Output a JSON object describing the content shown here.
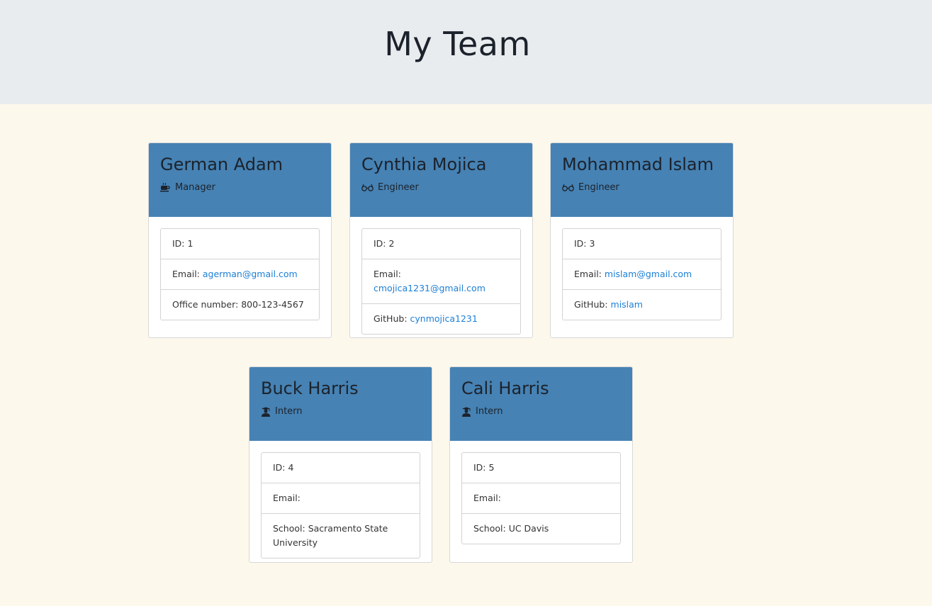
{
  "header": {
    "title": "My Team"
  },
  "labels": {
    "id": "ID: ",
    "email": "Email: ",
    "office": "Office number: ",
    "github": "GitHub: ",
    "school": "School: "
  },
  "team": [
    {
      "name": "German Adam",
      "role": "Manager",
      "role_icon": "coffee-icon",
      "id": "1",
      "email": "agerman@gmail.com",
      "office": "800-123-4567"
    },
    {
      "name": "Cynthia Mojica",
      "role": "Engineer",
      "role_icon": "glasses-icon",
      "id": "2",
      "email": "cmojica1231@gmail.com",
      "github": "cynmojica1231"
    },
    {
      "name": "Mohammad Islam",
      "role": "Engineer",
      "role_icon": "glasses-icon",
      "id": "3",
      "email": "mislam@gmail.com",
      "github": "mislam"
    },
    {
      "name": "Buck Harris",
      "role": "Intern",
      "role_icon": "graduate-icon",
      "id": "4",
      "email": "",
      "school": "Sacramento State University"
    },
    {
      "name": "Cali Harris",
      "role": "Intern",
      "role_icon": "graduate-icon",
      "id": "5",
      "email": "",
      "school": "UC Davis"
    }
  ],
  "colors": {
    "header_bg": "#e9ecef",
    "page_bg": "#fdf8ec",
    "card_header": "#4682b4",
    "link": "#1c7fd6"
  }
}
